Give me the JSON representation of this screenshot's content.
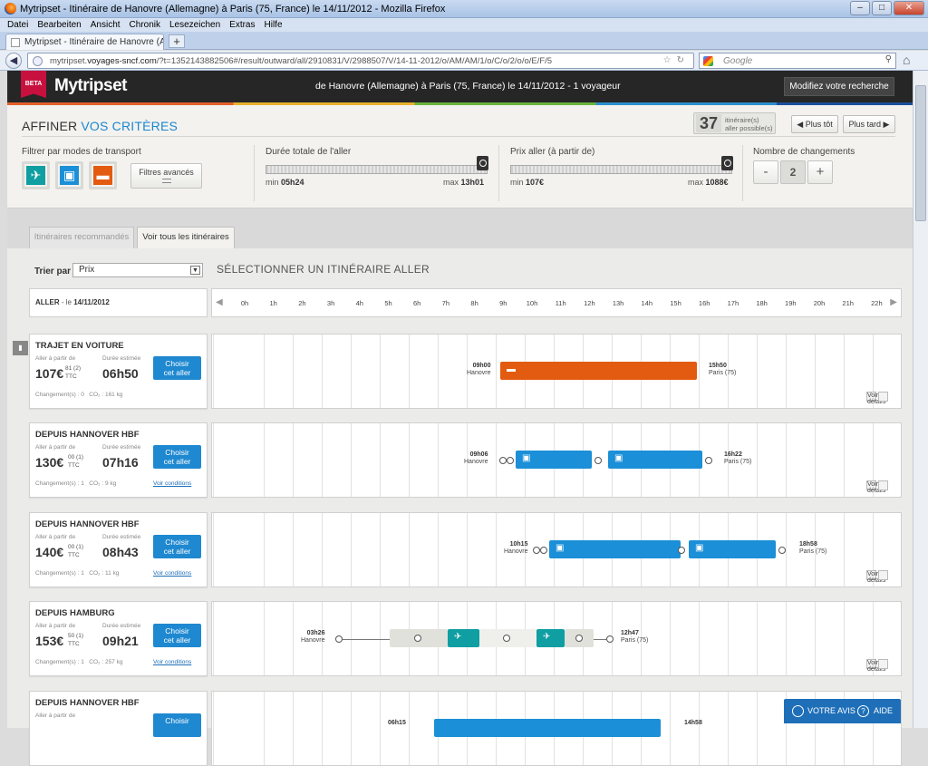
{
  "window": {
    "title": "Mytripset - Itinéraire de Hanovre (Allemagne) à Paris (75, France) le 14/11/2012 - Mozilla Firefox",
    "buttons": [
      "–",
      "□",
      "✕"
    ]
  },
  "menu": [
    "Datei",
    "Bearbeiten",
    "Ansicht",
    "Chronik",
    "Lesezeichen",
    "Extras",
    "Hilfe"
  ],
  "browser": {
    "tab_title": "Mytripset - Itinéraire de Hanovre (Allem...",
    "new_tab": "+",
    "url_prefix": "mytripset.",
    "url_host": "voyages-sncf.com",
    "url_rest": "/?t=1352143882506#/result/outward/all/2910831/V/2988507/V/14-11-2012/o/AM/AM/1/o/C/o/2/o/o/E/F/5",
    "search_placeholder": "Google"
  },
  "header": {
    "beta": "BETA",
    "logo": "Mytripset",
    "route": "de Hanovre (Allemagne) à Paris (75, France) le 14/11/2012 - 1 voyageur",
    "modify": "Modifiez votre recherche"
  },
  "filters": {
    "title_a": "AFFINER ",
    "title_b": "VOS CRITÈRES",
    "count": "37",
    "count_label_1": "itinéraire(s)",
    "count_label_2": "aller possible(s)",
    "earlier": "◀ Plus tôt",
    "later": "Plus tard ▶",
    "modes_label": "Filtrer par modes de transport",
    "advanced": "Filtres avancés",
    "duration_label": "Durée totale de l'aller",
    "duration_min_prefix": "min ",
    "duration_min": "05h24",
    "duration_max_prefix": "max ",
    "duration_max": "13h01",
    "price_label": "Prix aller (à partir de)",
    "price_min_prefix": "min ",
    "price_min": "107€",
    "price_max_prefix": "max ",
    "price_max": "1088€",
    "changes_label": "Nombre de changements",
    "changes_minus": "-",
    "changes_value": "2",
    "changes_plus": "+"
  },
  "tabs": {
    "recommended": "Itinéraires recommandés",
    "all": "Voir tous les itinéraires"
  },
  "sort": {
    "label": "Trier par",
    "value": "Prix",
    "select_heading": "SÉLECTIONNER UN ITINÉRAIRE ALLER"
  },
  "aller": {
    "label": "ALLER",
    "date_prefix": " - le ",
    "date": "14/11/2012"
  },
  "hours": [
    "0h",
    "1h",
    "2h",
    "3h",
    "4h",
    "5h",
    "6h",
    "7h",
    "8h",
    "9h",
    "10h",
    "11h",
    "12h",
    "13h",
    "14h",
    "15h",
    "16h",
    "17h",
    "18h",
    "19h",
    "20h",
    "21h",
    "22h"
  ],
  "colors": {
    "accent": "#1b8fd7",
    "car": "#e35b10",
    "flight": "#0f9ea2",
    "header": "#262626",
    "beta": "#c8103e"
  },
  "common": {
    "aller_label_1": "Aller à partir de",
    "price_suffix": "TTC",
    "duration_label": "Durée estimée",
    "choose_1": "Choisir",
    "choose_2": "cet aller",
    "details": "Voir détails",
    "conditions": "Voir conditions"
  },
  "results": [
    {
      "title": "TRAJET EN VOITURE",
      "price": "107€",
      "cents": "81",
      "note": "(2)",
      "duration": "06h50",
      "changes": "Changement(s) : 0",
      "co2": "CO₂ : 161 kg",
      "dep_time": "09h00",
      "dep_place": "Hanovre",
      "arr_time": "15h50",
      "arr_place": "Paris (75)"
    },
    {
      "title": "DEPUIS HANNOVER HBF",
      "price": "130€",
      "cents": "00",
      "note": "(1)",
      "duration": "07h16",
      "changes": "Changement(s) : 1",
      "co2": "CO₂ : 9 kg",
      "dep_time": "09h06",
      "dep_place": "Hanovre",
      "arr_time": "16h22",
      "arr_place": "Paris (75)"
    },
    {
      "title": "DEPUIS HANNOVER HBF",
      "price": "140€",
      "cents": "00",
      "note": "(1)",
      "duration": "08h43",
      "changes": "Changement(s) : 1",
      "co2": "CO₂ : 11 kg",
      "dep_time": "10h15",
      "dep_place": "Hanovre",
      "arr_time": "18h58",
      "arr_place": "Paris (75)"
    },
    {
      "title": "DEPUIS HAMBURG",
      "price": "153€",
      "cents": "50",
      "note": "(1)",
      "duration": "09h21",
      "changes": "Changement(s) : 1",
      "co2": "CO₂ : 257 kg",
      "dep_time": "03h26",
      "dep_place": "Hanovre",
      "arr_time": "12h47",
      "arr_place": "Paris (75)"
    },
    {
      "title": "DEPUIS HANNOVER HBF",
      "dep_time": "06h15",
      "arr_time": "14h58"
    }
  ],
  "feedback": {
    "avis": "VOTRE AVIS",
    "aide": "AIDE"
  }
}
